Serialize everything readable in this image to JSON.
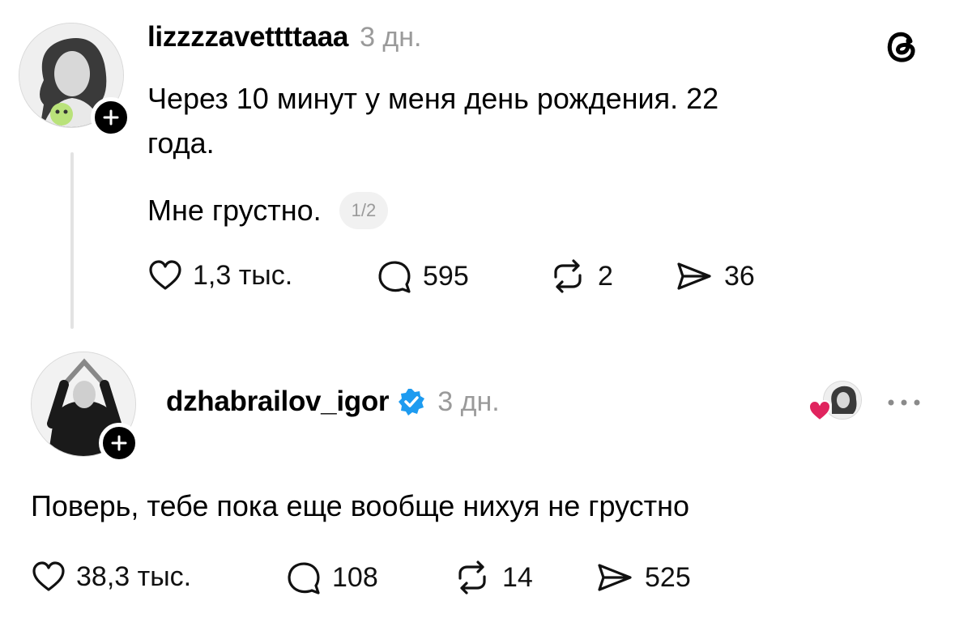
{
  "app": {
    "logo_icon": "threads-logo-icon"
  },
  "post": {
    "username": "lizzzzavettttaaa",
    "time": "3 дн.",
    "text_line1": "Через 10 минут у меня день рождения. 22",
    "text_line2": "года.",
    "text_line3": "Мне грустно.",
    "page_indicator": "1/2",
    "likes": "1,3 тыс.",
    "comments": "595",
    "reposts": "2",
    "shares": "36"
  },
  "reply": {
    "username": "dzhabrailov_igor",
    "time": "3 дн.",
    "text": "Поверь, тебе пока еще вообще нихуя не грустно",
    "likes": "38,3 тыс.",
    "comments": "108",
    "reposts": "14",
    "shares": "525"
  },
  "colors": {
    "verified": "#1d9bf0",
    "heart": "#e0245e",
    "muted": "#9a9a9a",
    "thread_line": "#e3e3e3"
  }
}
